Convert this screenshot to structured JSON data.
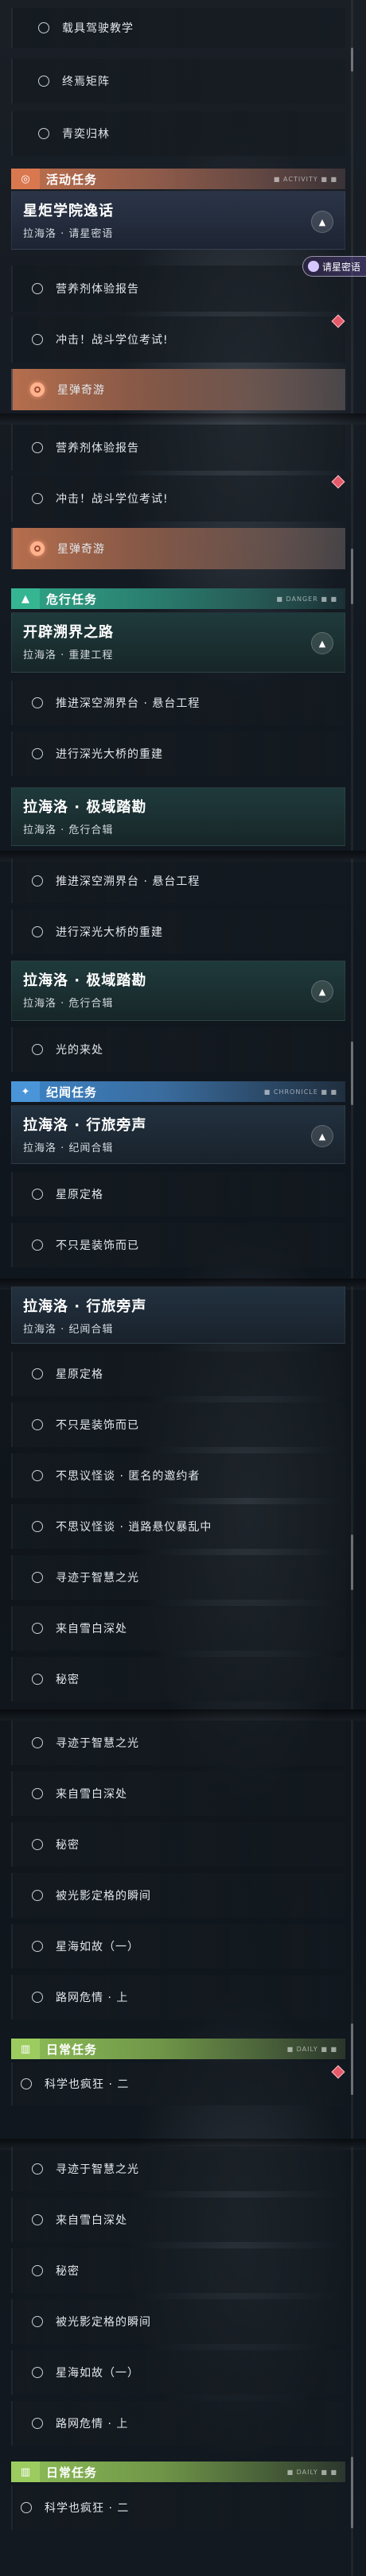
{
  "panel1": {
    "rows_top": [
      "载具驾驶教学",
      "终焉矩阵",
      "青奕归林"
    ],
    "section": {
      "title": "活动任务",
      "deco": "■ ACTIVITY ■ ■"
    },
    "quest": {
      "title": "星炬学院逸话",
      "subtitle": "拉海洛 · 请星密语"
    },
    "tracker": "请星密语",
    "rows": [
      "营养剂体验报告",
      "冲击！战斗学位考试!"
    ],
    "selected": "星弹奇游"
  },
  "panel2": {
    "rows_top": [
      "营养剂体验报告",
      "冲击！战斗学位考试!"
    ],
    "selected": "星弹奇游",
    "section": {
      "title": "危行任务",
      "deco": "■ DANGER ■ ■"
    },
    "quest": {
      "title": "开辟溯界之路",
      "subtitle": "拉海洛 · 重建工程"
    },
    "rows": [
      "推进深空溯界台 · 悬台工程",
      "进行深光大桥的重建"
    ],
    "quest2": {
      "title": "拉海洛 · 极域踏勘",
      "subtitle": "拉海洛 · 危行合辑"
    }
  },
  "panel3": {
    "rows_top": [
      "推进深空溯界台 · 悬台工程",
      "进行深光大桥的重建"
    ],
    "quest": {
      "title": "拉海洛 · 极域踏勘",
      "subtitle": "拉海洛 · 危行合辑"
    },
    "rows": [
      "光的来处"
    ],
    "section": {
      "title": "纪闻任务",
      "deco": "■ CHRONICLE ■ ■"
    },
    "quest2": {
      "title": "拉海洛 · 行旅旁声",
      "subtitle": "拉海洛 · 纪闻合辑"
    },
    "rows2": [
      "星原定格",
      "不只是装饰而已"
    ]
  },
  "panel4": {
    "quest": {
      "title": "拉海洛 · 行旅旁声",
      "subtitle": "拉海洛 · 纪闻合辑"
    },
    "rows": [
      "星原定格",
      "不只是装饰而已",
      "不思议怪谈 · 匿名的邀约者",
      "不思议怪谈 · 逍路悬仪暴乱中",
      "寻迹于智慧之光",
      "来自雪白深处",
      "秘密"
    ]
  },
  "panel5": {
    "rows": [
      "寻迹于智慧之光",
      "来自雪白深处",
      "秘密",
      "被光影定格的瞬间",
      "星海如故（一）",
      "路网危情 · 上"
    ],
    "section": {
      "title": "日常任务",
      "deco": "■ DAILY ■ ■"
    },
    "daily": [
      "科学也疯狂 · 二"
    ]
  },
  "panel6": {
    "rows": [
      "寻迹于智慧之光",
      "来自雪白深处",
      "秘密",
      "被光影定格的瞬间",
      "星海如故（一）",
      "路网危情 · 上"
    ],
    "section": {
      "title": "日常任务",
      "deco": "■ DAILY ■ ■"
    },
    "daily": [
      "科学也疯狂 · 二"
    ]
  },
  "icons": {
    "activity": "spiral-ticket-icon",
    "danger": "warning-triangle-icon",
    "chronicle": "four-point-star-icon",
    "daily": "book-icon",
    "collapse": "chevron-up-icon",
    "tracked": "red-diamond-icon"
  },
  "colors": {
    "activity": "#c1714d",
    "danger": "#2ea688",
    "chronicle": "#3c84c8",
    "daily": "#8fbf57",
    "selected": "#b56e4d",
    "tracked": "#e45a6a"
  }
}
